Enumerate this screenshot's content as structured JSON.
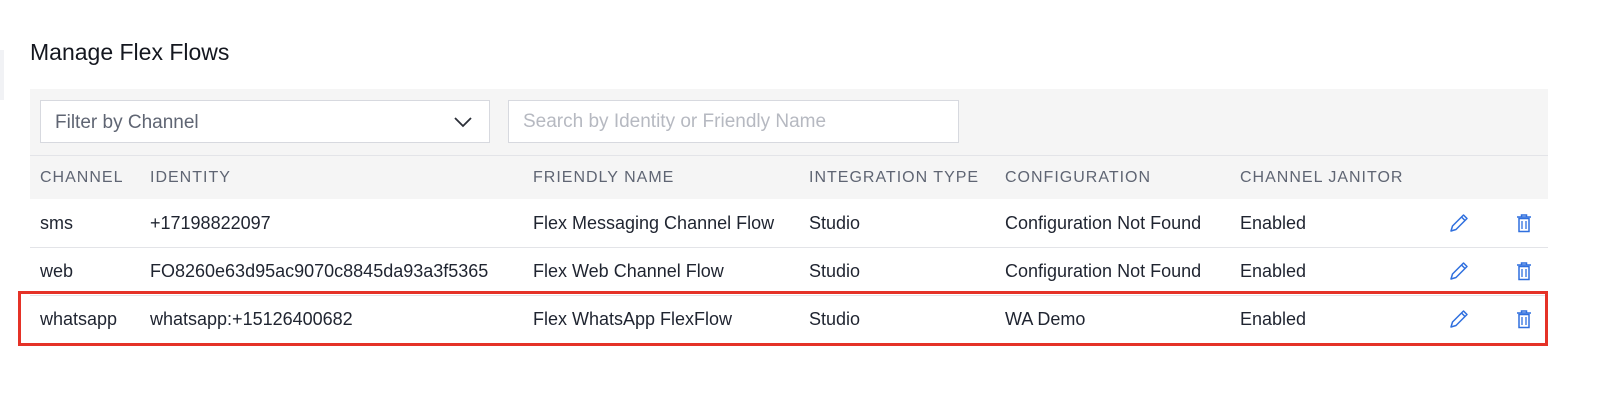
{
  "page": {
    "title": "Manage Flex Flows"
  },
  "filters": {
    "channel_select": {
      "value": "Filter by Channel"
    },
    "search": {
      "placeholder": "Search by Identity or Friendly Name",
      "value": ""
    }
  },
  "table": {
    "columns": [
      "CHANNEL",
      "IDENTITY",
      "FRIENDLY NAME",
      "INTEGRATION TYPE",
      "CONFIGURATION",
      "CHANNEL JANITOR"
    ],
    "rows": [
      {
        "channel": "sms",
        "identity": "+17198822097",
        "friendly_name": "Flex Messaging Channel Flow",
        "integration_type": "Studio",
        "configuration": "Configuration Not Found",
        "channel_janitor": "Enabled"
      },
      {
        "channel": "web",
        "identity": "FO8260e63d95ac9070c8845da93a3f5365",
        "friendly_name": "Flex Web Channel Flow",
        "integration_type": "Studio",
        "configuration": "Configuration Not Found",
        "channel_janitor": "Enabled"
      },
      {
        "channel": "whatsapp",
        "identity": "whatsapp:+15126400682",
        "friendly_name": "Flex WhatsApp FlexFlow",
        "integration_type": "Studio",
        "configuration": "WA Demo",
        "channel_janitor": "Enabled"
      }
    ],
    "row_actions": {
      "edit_icon": "pencil-icon",
      "delete_icon": "trash-icon"
    }
  },
  "colors": {
    "accent": "#2f6fde",
    "highlight": "#e53227",
    "header_bg": "#f5f5f5"
  }
}
